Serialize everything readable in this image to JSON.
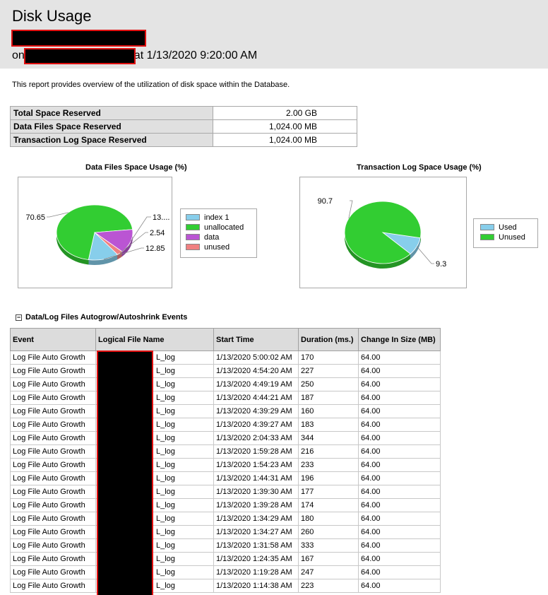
{
  "report": {
    "title": "Disk Usage",
    "on_prefix": "on",
    "at_text": "at 1/13/2020 9:20:00 AM",
    "description": "This report provides overview of the utilization of disk space within the Database."
  },
  "summary": [
    {
      "label": "Total Space Reserved",
      "value": "2.00 GB"
    },
    {
      "label": "Data Files Space Reserved",
      "value": "1,024.00 MB"
    },
    {
      "label": "Transaction Log Space Reserved",
      "value": "1,024.00 MB"
    }
  ],
  "chart_data": [
    {
      "type": "pie",
      "title": "Data Files Space Usage (%)",
      "labels": [
        "index 1",
        "unallocated",
        "data",
        "unused"
      ],
      "values": [
        12.85,
        70.65,
        13.96,
        2.54
      ],
      "data_labels": [
        "12.85",
        "70.65",
        "13....",
        "2.54"
      ],
      "colors": [
        "#87ceeb",
        "#32cd32",
        "#ba55d3",
        "#f08080"
      ],
      "legend": "right"
    },
    {
      "type": "pie",
      "title": "Transaction Log Space Usage (%)",
      "labels": [
        "Used",
        "Unused"
      ],
      "values": [
        9.3,
        90.7
      ],
      "data_labels": [
        "9.3",
        "90.7"
      ],
      "colors": [
        "#87ceeb",
        "#32cd32"
      ],
      "legend": "right"
    }
  ],
  "events": {
    "section_title": "Data/Log Files Autogrow/Autoshrink Events",
    "toggle_symbol": "−",
    "headers": [
      "Event",
      "Logical File Name",
      "Start Time",
      "Duration (ms.)",
      "Change In Size (MB)"
    ],
    "rows": [
      [
        "Log File Auto Growth",
        "L_log",
        "1/13/2020 5:00:02 AM",
        "170",
        "64.00"
      ],
      [
        "Log File Auto Growth",
        "L_log",
        "1/13/2020 4:54:20 AM",
        "227",
        "64.00"
      ],
      [
        "Log File Auto Growth",
        "L_log",
        "1/13/2020 4:49:19 AM",
        "250",
        "64.00"
      ],
      [
        "Log File Auto Growth",
        "L_log",
        "1/13/2020 4:44:21 AM",
        "187",
        "64.00"
      ],
      [
        "Log File Auto Growth",
        "L_log",
        "1/13/2020 4:39:29 AM",
        "160",
        "64.00"
      ],
      [
        "Log File Auto Growth",
        "L_log",
        "1/13/2020 4:39:27 AM",
        "183",
        "64.00"
      ],
      [
        "Log File Auto Growth",
        "L_log",
        "1/13/2020 2:04:33 AM",
        "344",
        "64.00"
      ],
      [
        "Log File Auto Growth",
        "L_log",
        "1/13/2020 1:59:28 AM",
        "216",
        "64.00"
      ],
      [
        "Log File Auto Growth",
        "L_log",
        "1/13/2020 1:54:23 AM",
        "233",
        "64.00"
      ],
      [
        "Log File Auto Growth",
        "L_log",
        "1/13/2020 1:44:31 AM",
        "196",
        "64.00"
      ],
      [
        "Log File Auto Growth",
        "L_log",
        "1/13/2020 1:39:30 AM",
        "177",
        "64.00"
      ],
      [
        "Log File Auto Growth",
        "L_log",
        "1/13/2020 1:39:28 AM",
        "174",
        "64.00"
      ],
      [
        "Log File Auto Growth",
        "L_log",
        "1/13/2020 1:34:29 AM",
        "180",
        "64.00"
      ],
      [
        "Log File Auto Growth",
        "L_log",
        "1/13/2020 1:34:27 AM",
        "260",
        "64.00"
      ],
      [
        "Log File Auto Growth",
        "L_log",
        "1/13/2020 1:31:58 AM",
        "333",
        "64.00"
      ],
      [
        "Log File Auto Growth",
        "L_log",
        "1/13/2020 1:24:35 AM",
        "167",
        "64.00"
      ],
      [
        "Log File Auto Growth",
        "L_log",
        "1/13/2020 1:19:28 AM",
        "247",
        "64.00"
      ],
      [
        "Log File Auto Growth",
        "L_log",
        "1/13/2020 1:14:38 AM",
        "223",
        "64.00"
      ]
    ]
  }
}
